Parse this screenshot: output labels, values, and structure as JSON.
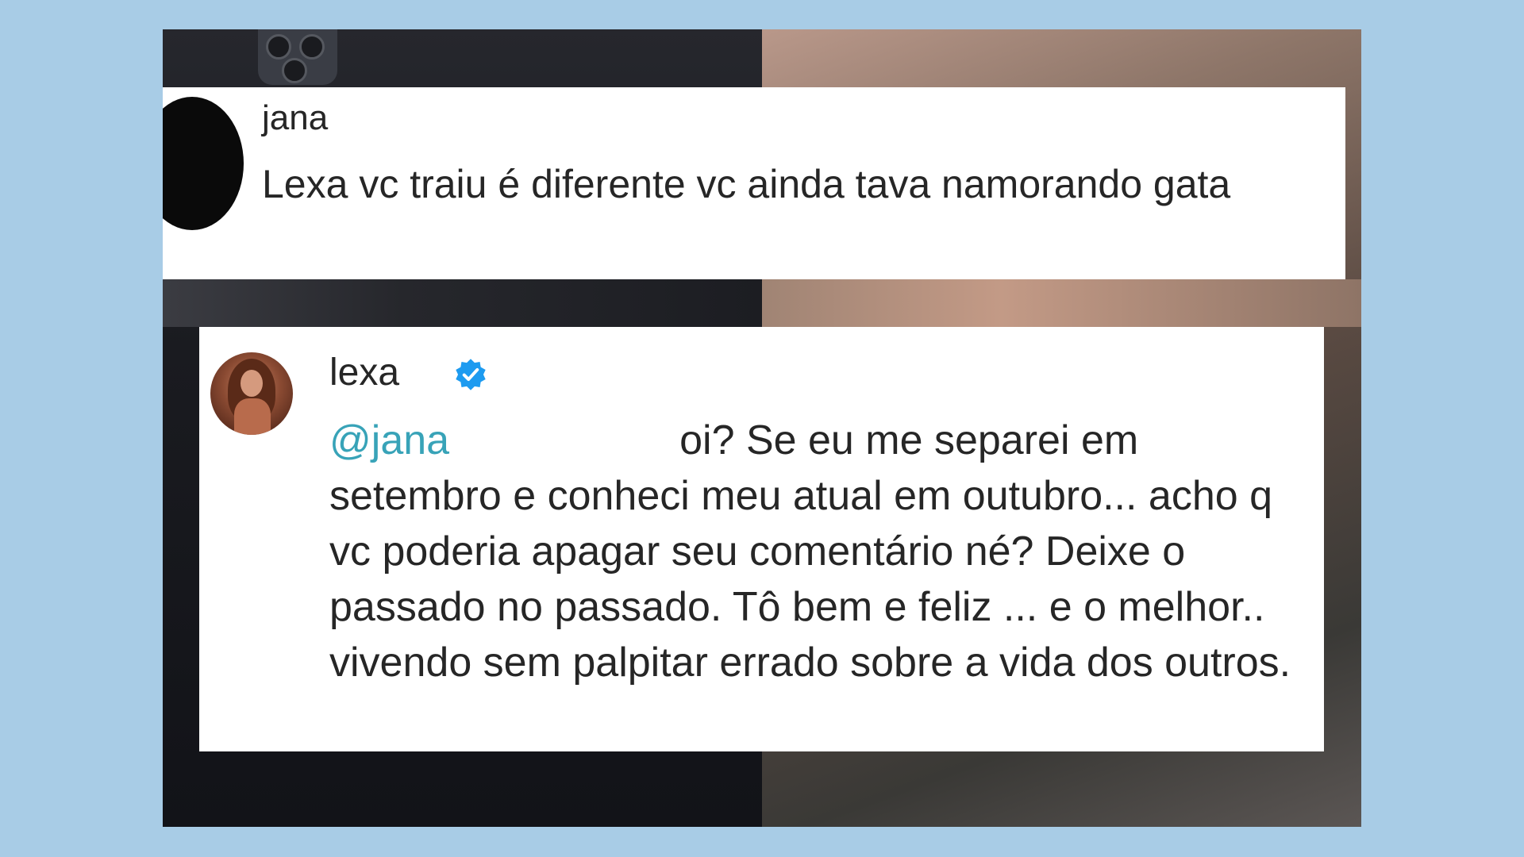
{
  "comments": [
    {
      "username": "jana",
      "text": "Lexa vc traiu é diferente vc ainda tava namorando gata"
    },
    {
      "username": "lexa",
      "verified": true,
      "mention": "@jana",
      "text": "oi? Se eu me separei em setembro e conheci meu atual em outubro... acho q vc poderia apagar seu comentário né? Deixe o passado no passado. Tô bem e feliz ... e o melhor.. vivendo sem palpitar errado sobre a vida dos outros."
    }
  ],
  "colors": {
    "page_background": "#a8cce6",
    "mention": "#38a3b8",
    "verified_badge": "#1d9bf0",
    "text": "#262626"
  },
  "icons": {
    "verified": "verified-badge-icon"
  }
}
